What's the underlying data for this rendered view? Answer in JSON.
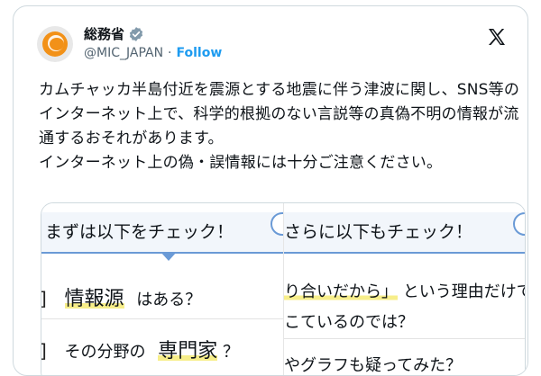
{
  "account": {
    "name": "総務省",
    "handle": "@MIC_JAPAN",
    "separator": "·",
    "follow_label": "Follow"
  },
  "tweet": {
    "text": "カムチャッカ半島付近を震源とする地震に伴う津波に関し、SNS等のインターネット上で、科学的根拠のない言説等の真偽不明の情報が流通するおそれがあります。\nインターネット上の偽・誤情報には十分ご注意ください。"
  },
  "media": {
    "left": {
      "heading": "まずは以下をチェック！",
      "items": [
        {
          "bracket": "]",
          "highlight": "情報源",
          "rest": "はある？"
        },
        {
          "bracket": "]",
          "prefix": "その分野の",
          "highlight": "専門家",
          "rest": "？"
        }
      ]
    },
    "right": {
      "heading": "さらに以下もチェック！",
      "items": [
        {
          "highlight": "り合いだから」",
          "rest": "という理由だけで"
        },
        {
          "text": "こているのでは？"
        },
        {
          "text": "やグラフも疑ってみた？"
        }
      ]
    }
  },
  "colors": {
    "follow": "#1d9bf0",
    "verified": "#829aab",
    "highlight": "#f7ee8a",
    "accent_line": "#6a9ad6",
    "logo_orange": "#f29118"
  },
  "icons": {
    "avatar": "mic-logo-icon",
    "verified": "verified-badge-icon",
    "platform": "x-logo-icon"
  }
}
